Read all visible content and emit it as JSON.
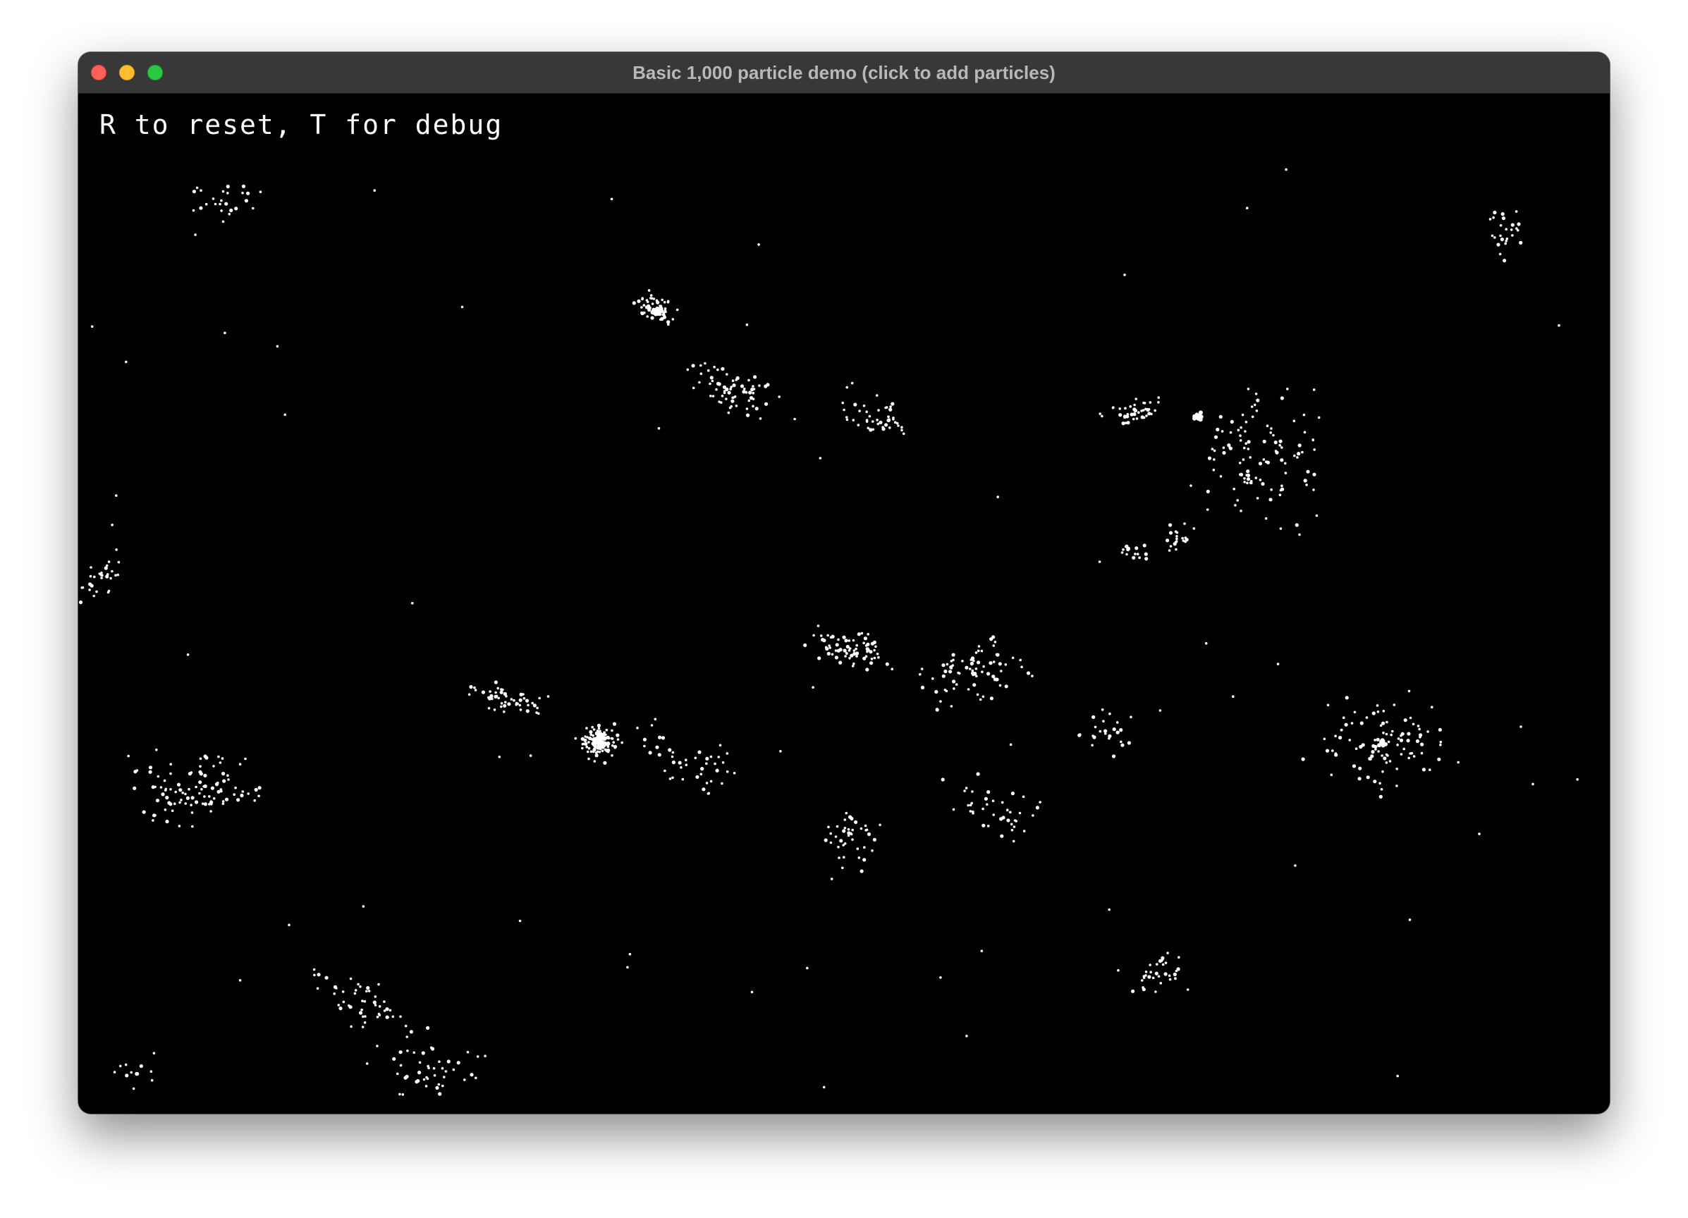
{
  "window": {
    "title": "Basic 1,000 particle demo (click to add particles)",
    "controls": [
      "close",
      "minimize",
      "zoom"
    ]
  },
  "canvas": {
    "hint_text": "R to reset, T for debug",
    "background": "#000000",
    "particle_color": "#ffffff",
    "particle_count": 1000
  }
}
